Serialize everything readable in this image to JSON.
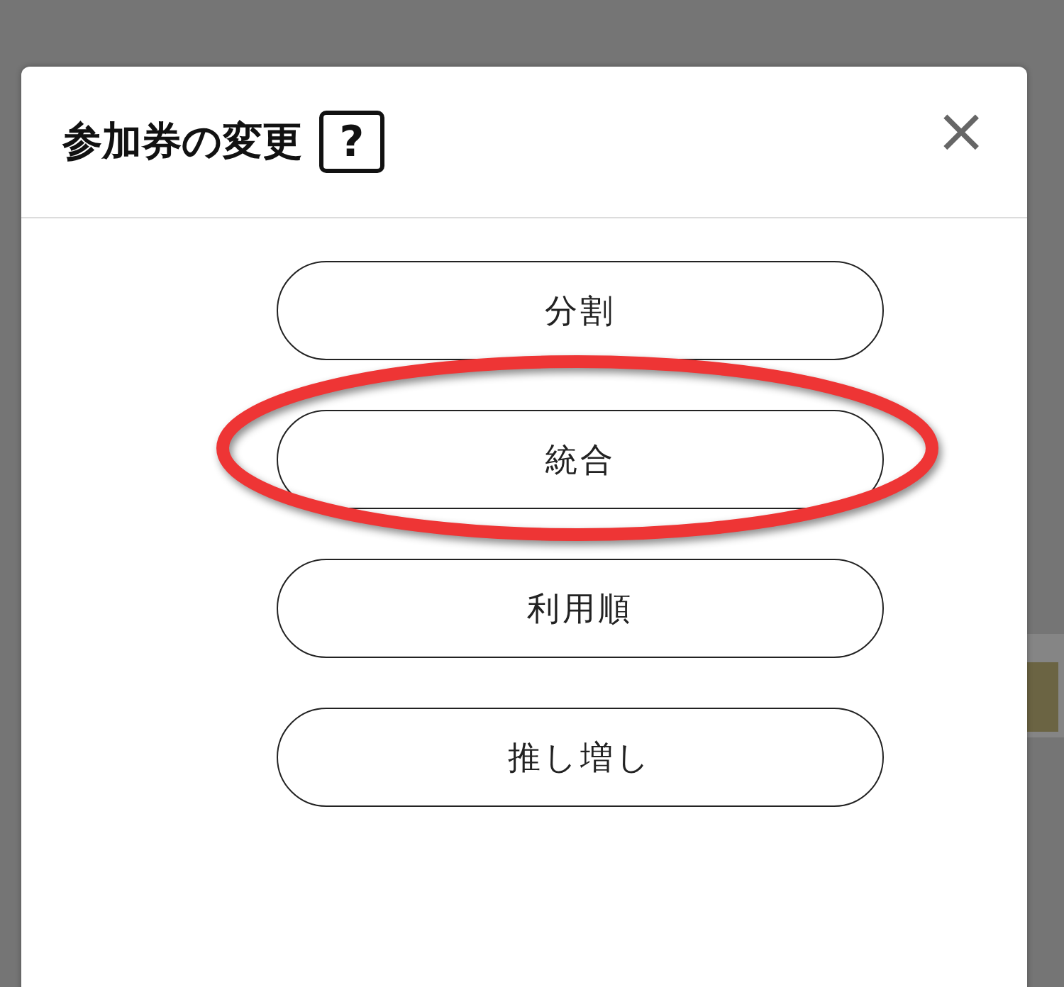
{
  "dialog": {
    "title": "参加券の変更",
    "help_label": "?",
    "close_label": "×"
  },
  "options": [
    {
      "label": "分割",
      "highlighted": false
    },
    {
      "label": "統合",
      "highlighted": true
    },
    {
      "label": "利用順",
      "highlighted": false
    },
    {
      "label": "推し増し",
      "highlighted": false
    }
  ]
}
